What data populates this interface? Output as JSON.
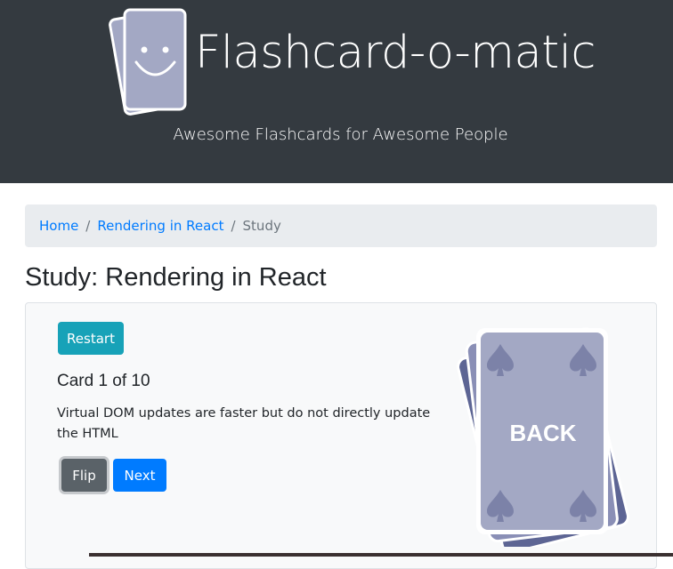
{
  "header": {
    "title": "Flashcard-o-matic",
    "subtitle": "Awesome Flashcards for Awesome People",
    "logo_icon": "smiley-cards-icon"
  },
  "breadcrumb": {
    "items": [
      {
        "label": "Home",
        "link": true
      },
      {
        "label": "Rendering in React",
        "link": true
      },
      {
        "label": "Study",
        "link": false
      }
    ],
    "separator": "/"
  },
  "page": {
    "title": "Study: Rendering in React"
  },
  "study": {
    "restart_label": "Restart",
    "card_count": "Card 1 of 10",
    "card_text": "Virtual DOM updates are faster but do not directly update the HTML",
    "flip_label": "Flip",
    "next_label": "Next",
    "card_back_label": "BACK"
  },
  "colors": {
    "header_bg": "#343a40",
    "breadcrumb_bg": "#e9ecef",
    "link": "#007bff",
    "restart": "#17a2b8",
    "flip": "#5a6268",
    "next": "#007bff",
    "card_face": "#a3a8c4",
    "card_back_shadow": "#5d6594"
  }
}
